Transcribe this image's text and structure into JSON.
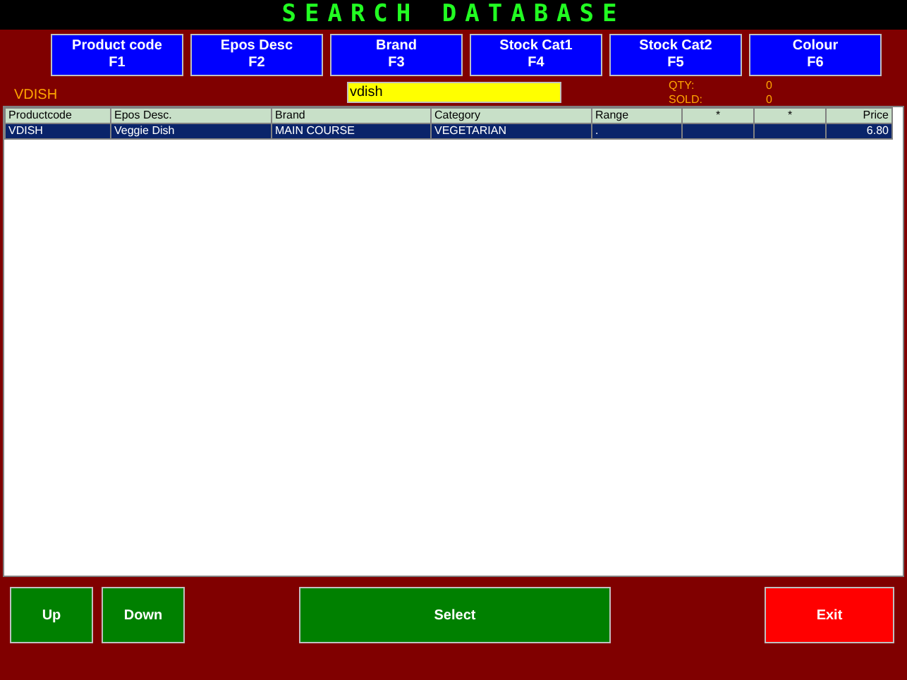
{
  "title": "SEARCH DATABASE",
  "search_buttons": [
    {
      "label": "Product code",
      "key": "F1"
    },
    {
      "label": "Epos Desc",
      "key": "F2"
    },
    {
      "label": "Brand",
      "key": "F3"
    },
    {
      "label": "Stock Cat1",
      "key": "F4"
    },
    {
      "label": "Stock Cat2",
      "key": "F5"
    },
    {
      "label": "Colour",
      "key": "F6"
    }
  ],
  "current_code": "VDISH",
  "search": {
    "value": "vdish"
  },
  "stats": [
    {
      "label": "QTY:",
      "value": "0"
    },
    {
      "label": "SOLD:",
      "value": "0"
    }
  ],
  "table": {
    "columns": [
      "Productcode",
      "Epos Desc.",
      "Brand",
      "Category",
      "Range",
      "*",
      "*",
      "Price"
    ],
    "rows": [
      {
        "selected": true,
        "cells": [
          "VDISH",
          "Veggie Dish",
          "MAIN COURSE",
          "VEGETARIAN",
          ".",
          "",
          "",
          "6.80"
        ]
      }
    ]
  },
  "bottom_buttons": [
    {
      "label": "Up",
      "kind": "nav"
    },
    {
      "label": "Down",
      "kind": "nav"
    },
    {
      "label": "Select",
      "kind": "confirm"
    },
    {
      "label": "Exit",
      "kind": "exit"
    }
  ]
}
